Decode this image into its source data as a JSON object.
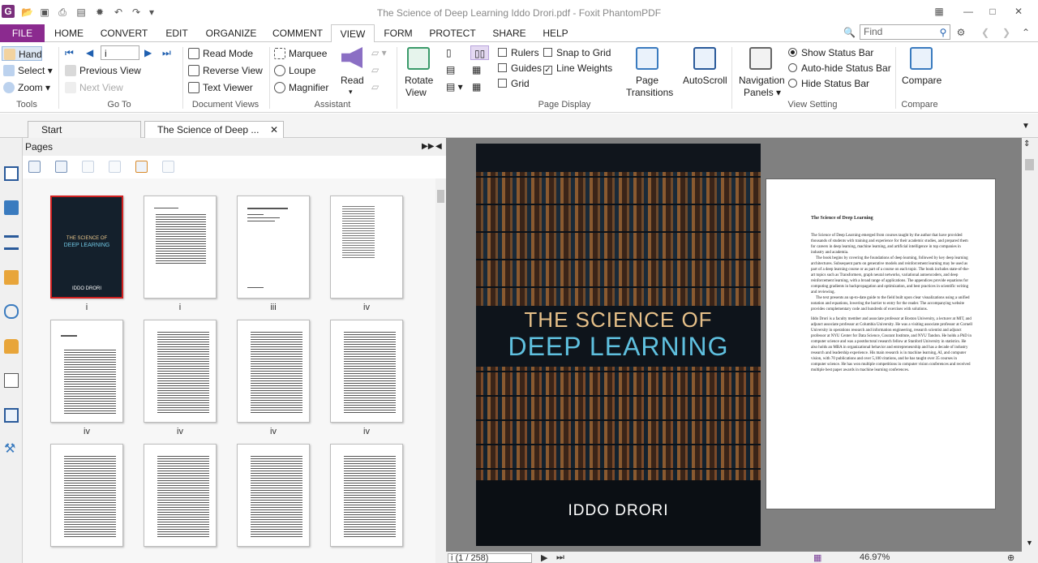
{
  "window": {
    "title": "The Science of Deep Learning Iddo Drori.pdf - Foxit PhantomPDF"
  },
  "menu": {
    "file": "FILE",
    "tabs": [
      "HOME",
      "CONVERT",
      "EDIT",
      "ORGANIZE",
      "COMMENT",
      "VIEW",
      "FORM",
      "PROTECT",
      "SHARE",
      "HELP"
    ],
    "active": "VIEW",
    "search_placeholder": "Find"
  },
  "ribbon": {
    "tools": {
      "hand": "Hand",
      "select": "Select",
      "zoom": "Zoom",
      "label": "Tools"
    },
    "goto": {
      "page_value": "i",
      "previous_view": "Previous View",
      "next_view": "Next View",
      "label": "Go To"
    },
    "docviews": {
      "read_mode": "Read Mode",
      "reverse_view": "Reverse View",
      "text_viewer": "Text Viewer",
      "label": "Document Views"
    },
    "assistant": {
      "marquee": "Marquee",
      "loupe": "Loupe",
      "magnifier": "Magnifier",
      "read": "Read",
      "label": "Assistant"
    },
    "pagedisplay": {
      "rotate": "Rotate",
      "rotate2": "View",
      "rulers": "Rulers",
      "guides": "Guides",
      "grid": "Grid",
      "snap": "Snap to Grid",
      "lineweights": "Line Weights",
      "transitions1": "Page",
      "transitions2": "Transitions",
      "autoscroll": "AutoScroll",
      "label": "Page Display"
    },
    "viewsetting": {
      "nav1": "Navigation",
      "nav2": "Panels",
      "show_status": "Show Status Bar",
      "autohide_status": "Auto-hide Status Bar",
      "hide_status": "Hide Status Bar",
      "label": "View Setting"
    },
    "compare": {
      "compare": "Compare",
      "label": "Compare"
    }
  },
  "tabs": {
    "start": "Start",
    "doc": "The Science of Deep ..."
  },
  "pages_panel": {
    "title": "Pages",
    "thumbs": [
      "i",
      "i",
      "iii",
      "iv",
      "iv",
      "iv",
      "iv",
      "iv",
      "",
      "",
      "",
      ""
    ]
  },
  "cover": {
    "line1": "THE SCIENCE OF",
    "line2": "DEEP LEARNING",
    "author": "IDDO DRORI"
  },
  "page2": {
    "title": "The Science of Deep Learning",
    "p1": "The Science of Deep Learning emerged from courses taught by the author that have provided thousands of students with training and experience for their academic studies, and prepared them for careers in deep learning, machine learning, and artificial intelligence in top companies in industry and academia.",
    "p2": "The book begins by covering the foundations of deep learning, followed by key deep learning architectures. Subsequent parts on generative models and reinforcement learning may be used as part of a deep learning course or as part of a course on each topic. The book includes state-of-the-art topics such as Transformers, graph neural networks, variational autoencoders, and deep reinforcement learning, with a broad range of applications. The appendices provide equations for computing gradients in backpropagation and optimization, and best practices in scientific writing and reviewing.",
    "p3": "The text presents an up-to-date guide to the field built upon clear visualizations using a unified notation and equations, lowering the barrier to entry for the reader. The accompanying website provides complementary code and hundreds of exercises with solutions.",
    "p4": "Iddo Drori is a faculty member and associate professor at Boston University, a lecturer at MIT, and adjunct associate professor at Columbia University. He was a visiting associate professor at Cornell University in operations research and information engineering, research scientist and adjunct professor at NYU Center for Data Science, Courant Institute, and NYU Tandon. He holds a PhD in computer science and was a postdoctoral research fellow at Stanford University in statistics. He also holds an MBA in organizational behavior and entrepreneurship and has a decade of industry research and leadership experience. His main research is in machine learning, AI, and computer vision, with 70 publications and over 5,100 citations, and he has taught over 35 courses in computer science. He has won multiple competitions in computer vision conferences and received multiple best paper awards in machine learning conferences."
  },
  "status": {
    "page": "i (1 / 258)",
    "zoom": "46.97%"
  }
}
